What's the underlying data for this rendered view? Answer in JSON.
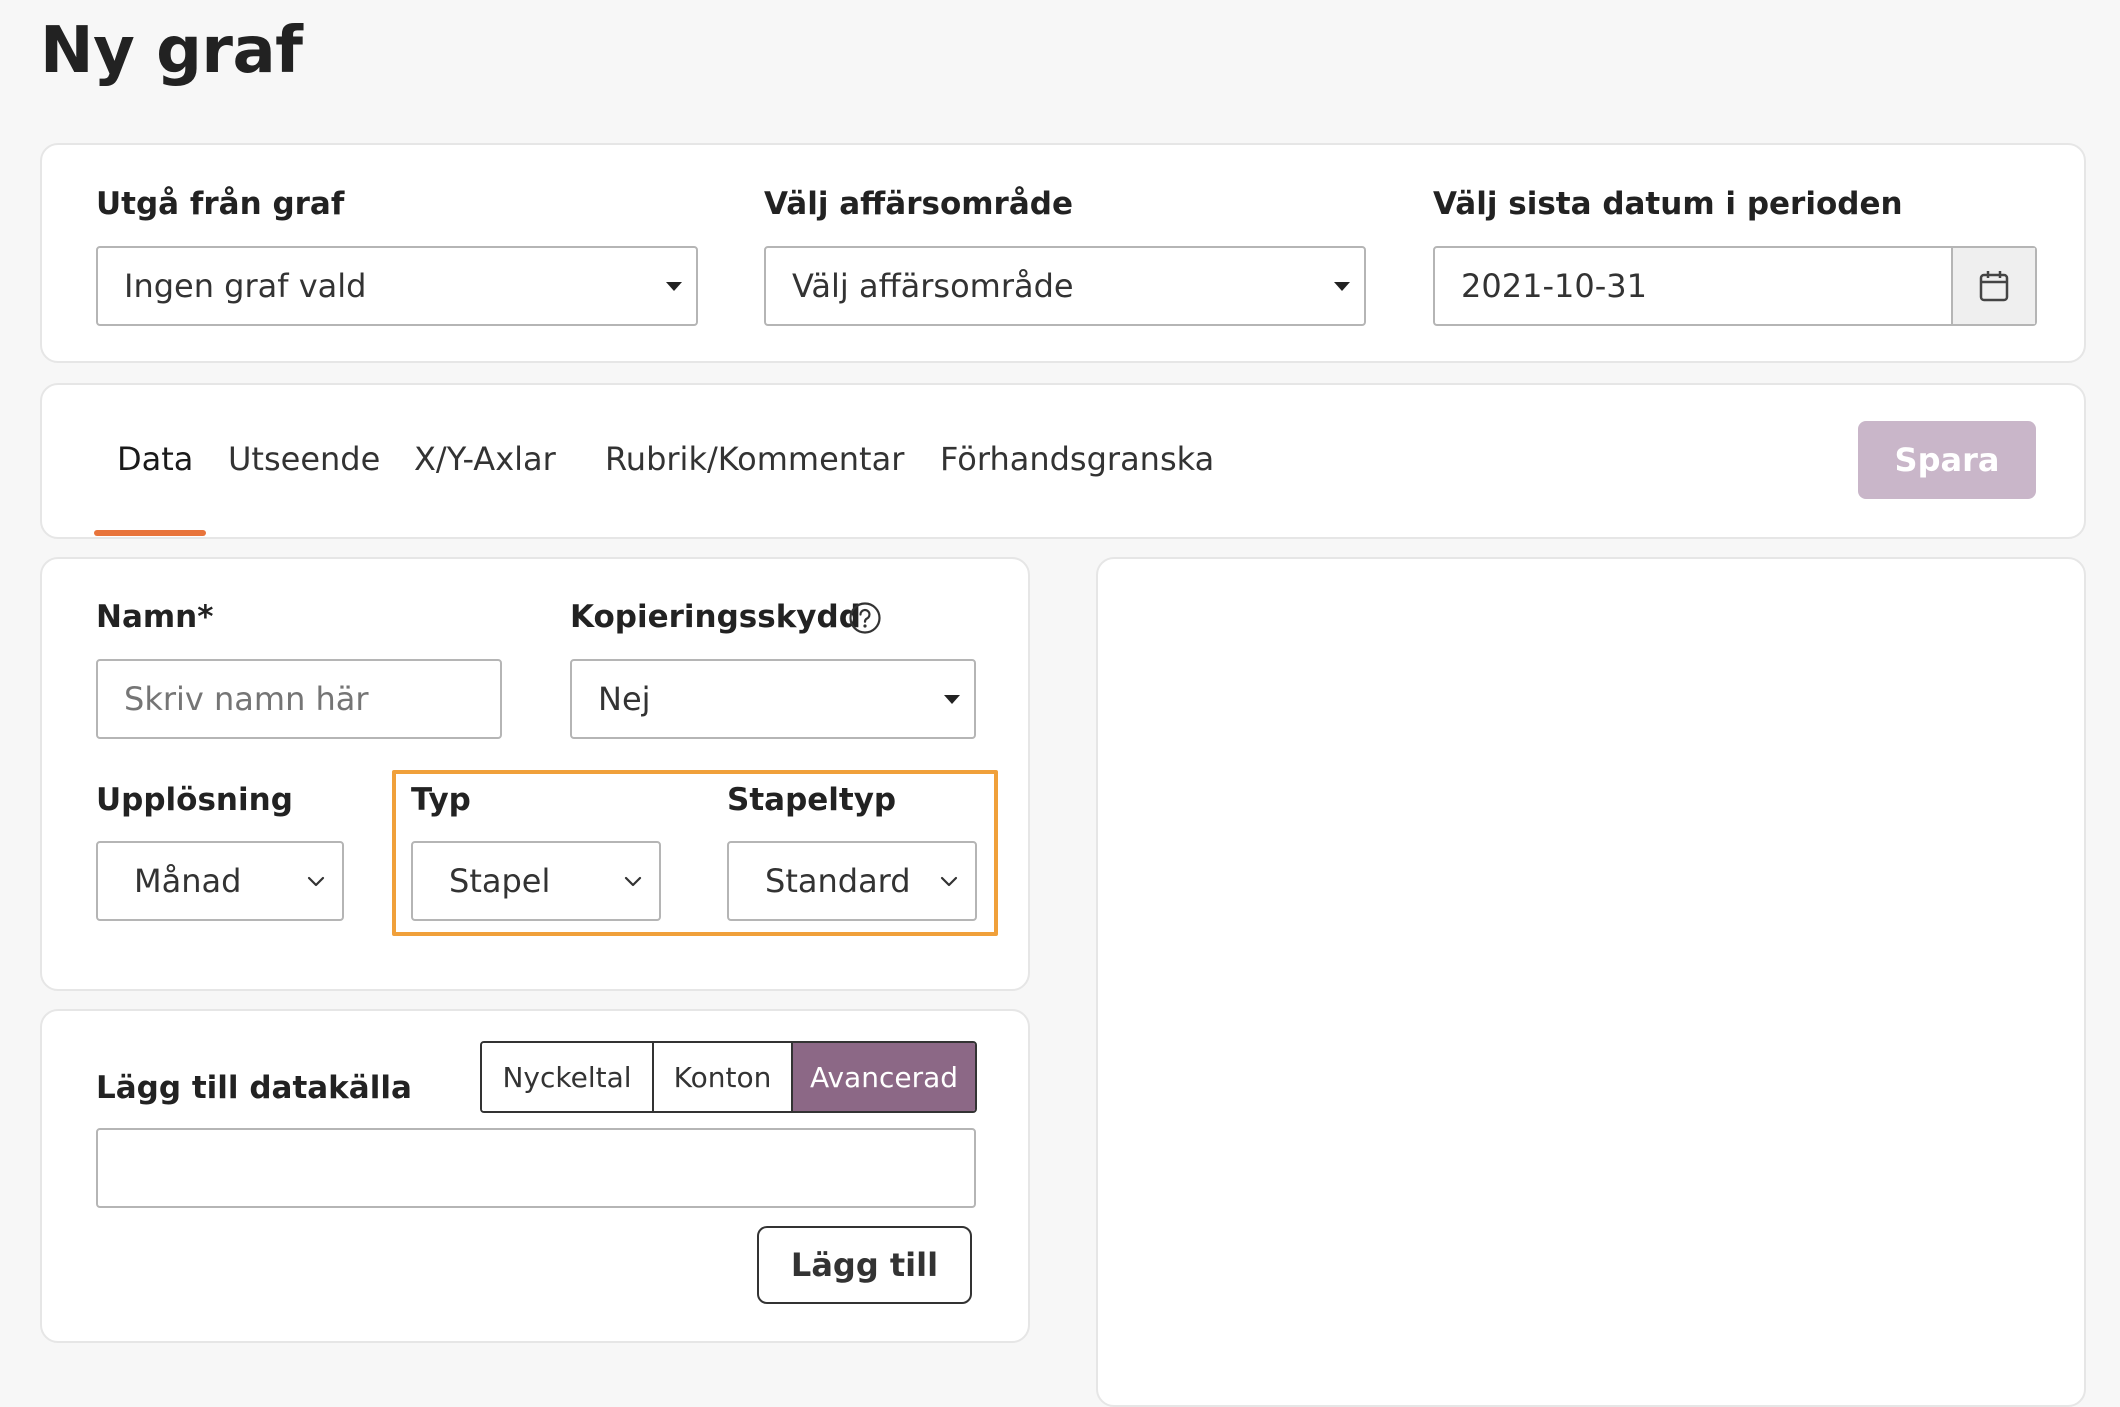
{
  "page": {
    "title": "Ny graf"
  },
  "filters": {
    "base_graph": {
      "label": "Utgå från graf",
      "value": "Ingen graf vald"
    },
    "business_area": {
      "label": "Välj affärsområde",
      "value": "Välj affärsområde"
    },
    "end_date": {
      "label": "Välj sista datum i perioden",
      "value": "2021-10-31",
      "button_icon": "calendar-icon"
    }
  },
  "tabs": {
    "items": [
      {
        "label": "Data",
        "active": true
      },
      {
        "label": "Utseende",
        "active": false
      },
      {
        "label": "X/Y-Axlar",
        "active": false
      },
      {
        "label": "Rubrik/Kommentar",
        "active": false
      },
      {
        "label": "Förhandsgranska",
        "active": false
      }
    ],
    "save_label": "Spara"
  },
  "form": {
    "name": {
      "label": "Namn*",
      "placeholder": "Skriv namn här",
      "value": ""
    },
    "copy_protection": {
      "label": "Kopieringsskydd",
      "value": "Nej",
      "icon": "help-circle-icon"
    },
    "resolution": {
      "label": "Upplösning",
      "value": "Månad"
    },
    "type": {
      "label": "Typ",
      "value": "Stapel"
    },
    "bar_type": {
      "label": "Stapeltyp",
      "value": "Standard"
    }
  },
  "datasource": {
    "label": "Lägg till datakälla",
    "modes": [
      {
        "label": "Nyckeltal",
        "selected": false
      },
      {
        "label": "Konton",
        "selected": false
      },
      {
        "label": "Avancerad",
        "selected": true
      }
    ],
    "input_value": "",
    "add_label": "Lägg till"
  },
  "colors": {
    "accent_tab": "#e8743b",
    "highlight": "#f0a03a",
    "selected_segment": "#8c6886",
    "save_disabled": "#c9b6c9"
  }
}
